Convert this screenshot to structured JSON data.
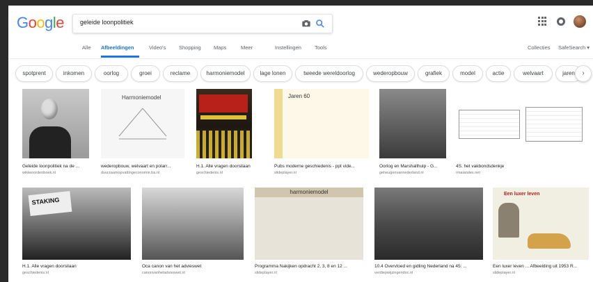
{
  "search": {
    "query": "geleide loonpolitiek"
  },
  "logo": {
    "letters": [
      "G",
      "o",
      "o",
      "g",
      "l",
      "e"
    ],
    "colors": [
      "#4285f4",
      "#ea4335",
      "#fbbc05",
      "#4285f4",
      "#34a853",
      "#ea4335"
    ]
  },
  "tabs": [
    {
      "label": "Alle"
    },
    {
      "label": "Afbeeldingen",
      "active": true
    },
    {
      "label": "Video's"
    },
    {
      "label": "Shopping"
    },
    {
      "label": "Maps"
    },
    {
      "label": "Meer"
    },
    {
      "label": "Instellingen"
    },
    {
      "label": "Tools"
    }
  ],
  "tabs_right": [
    {
      "label": "Collecties"
    },
    {
      "label": "SafeSearch ▾"
    }
  ],
  "chips": [
    "spotprent",
    "inkomen",
    "oorlog",
    "groei",
    "reclame",
    "harmoniemodel",
    "lage lonen",
    "tweede wereldoorlog",
    "wederopbouw",
    "grafiek",
    "model",
    "actie",
    "welvaart",
    "jaren"
  ],
  "results_row1": [
    {
      "title": "Geleide loonpolitiek na de ...",
      "source": "wikiwoordenboek.nl"
    },
    {
      "title": "wederopbouw, welvaart en polarr...",
      "source": "duurzaamopvattingeconomie.ba.nl"
    },
    {
      "title": "H.1. Alle vragen doorsilaan",
      "source": "geschiedenis.nl"
    },
    {
      "title": "Pubs moderne geschiedenis - ppt vide...",
      "source": "slideplayer.nl"
    },
    {
      "title": "Oorlog en Marshallhulp - G...",
      "source": "geheugenvannederland.nl"
    },
    {
      "title": "4S. het vakbondsdenkje",
      "source": "rmaiandes.net"
    }
  ],
  "results_row2": [
    {
      "title": "H.1. Alle vragen doorsilaan",
      "source": "geschiedenis.nl"
    },
    {
      "title": "Oca canon van het advieswet",
      "source": "canonvanhetadvieswet.nl"
    },
    {
      "title": "Programma Nakijken opdracht 2, 3, 8 en 12 ...",
      "source": "slideplayer.nl"
    },
    {
      "title": "10.4 Overvloed en gidling Nederland na 45: ...",
      "source": "verdiepwijzingendoc.nl"
    },
    {
      "title": "Een luxer leven ... Afbeelding uit 1953 R...",
      "source": "slideplayer.nl"
    }
  ],
  "thumbs": {
    "harmoniemodel": "Harmoniemodel",
    "jaren60": "Jaren 60",
    "poster_line1": "NU IS NEDERLAND WEER",
    "poster_line2": "DIENT",
    "protest_sign": "STAKING",
    "slide_header": "harmoniemodel",
    "ad_heading": "Een luxer leven"
  },
  "icons": {
    "camera": "camera-icon",
    "search": "search-icon",
    "apps": "apps-grid-icon",
    "notifications": "notifications-icon",
    "avatar": "avatar"
  }
}
